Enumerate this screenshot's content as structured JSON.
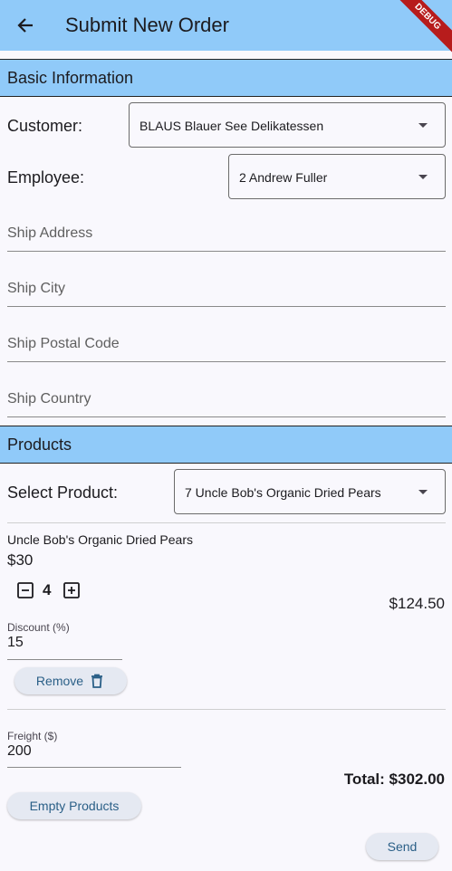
{
  "appbar": {
    "title": "Submit New Order",
    "debug_badge": "DEBUG"
  },
  "basic": {
    "heading": "Basic Information",
    "customer_label": "Customer:",
    "customer_value": "BLAUS Blauer See Delikatessen",
    "employee_label": "Employee:",
    "employee_value": "2 Andrew Fuller",
    "ship_address_placeholder": "Ship Address",
    "ship_city_placeholder": "Ship City",
    "ship_postal_placeholder": "Ship Postal Code",
    "ship_country_placeholder": "Ship Country"
  },
  "products": {
    "heading": "Products",
    "select_label": "Select Product:",
    "select_value": "7 Uncle Bob's Organic Dried Pears",
    "item": {
      "name": "Uncle Bob's Organic Dried Pears",
      "price": "$30",
      "quantity": "4",
      "line_total": "$124.50",
      "discount_label": "Discount (%)",
      "discount_value": "15",
      "remove_label": "Remove"
    }
  },
  "freight": {
    "label": "Freight ($)",
    "value": "200"
  },
  "total_text": "Total: $302.00",
  "buttons": {
    "empty_products": "Empty Products",
    "send": "Send"
  },
  "colors": {
    "appbar": "#90caf9",
    "background": "#f9f8fd",
    "button_text": "#2a5f87"
  }
}
